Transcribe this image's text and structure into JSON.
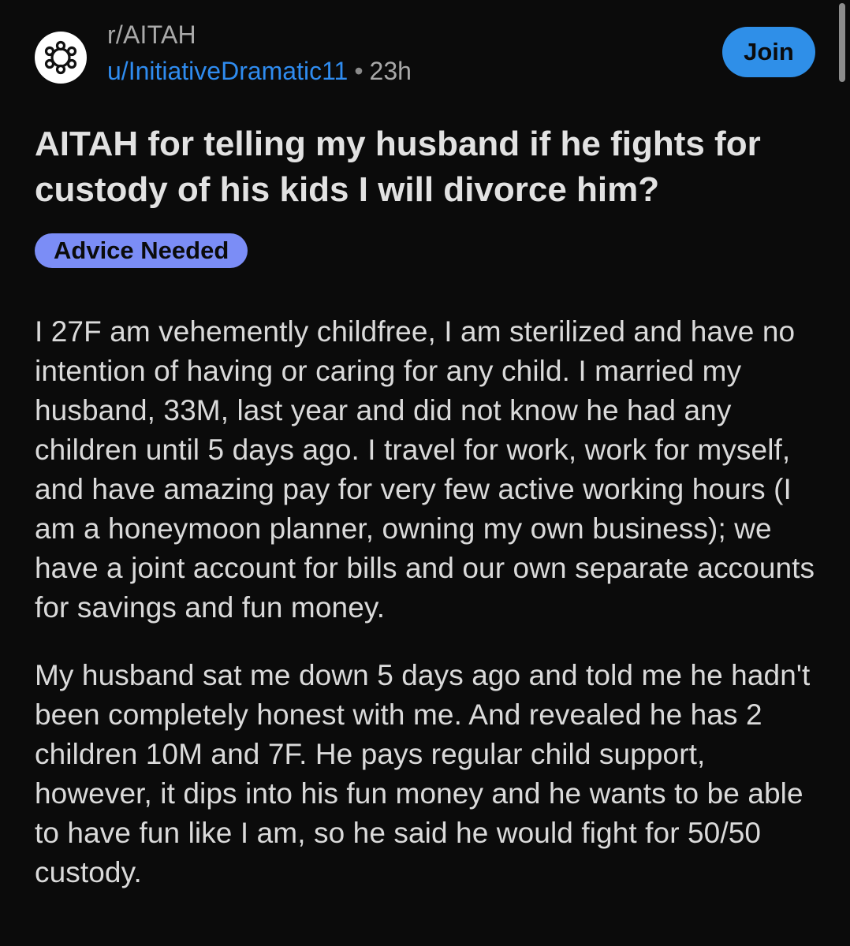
{
  "header": {
    "subreddit": "r/AITAH",
    "author": "u/InitiativeDramatic11",
    "separator": "•",
    "age": "23h",
    "join_label": "Join",
    "avatar_icon": "snoo-avatar-icon"
  },
  "post": {
    "title": "AITAH for telling my husband if he fights for custody of his kids I will divorce him?",
    "flair": "Advice Needed",
    "paragraphs": [
      "I 27F am vehemently childfree, I am sterilized and have no intention of having or caring for any child. I married my husband, 33M, last year and did not know he had any children until 5 days ago. I travel for work, work for myself, and have amazing pay for very few active working hours (I am a honeymoon planner, owning my own business); we have a joint account for bills and our own separate accounts for savings and fun money.",
      "My husband sat me down 5 days ago and told me he hadn't been completely honest with me. And revealed he has 2 children 10M and 7F. He pays regular child support, however, it dips into his fun money and he wants to be able to have fun like I am, so he said he would fight for 50/50 custody."
    ]
  },
  "colors": {
    "background": "#0b0b0b",
    "link": "#2f8cf0",
    "join_button": "#2f8fe8",
    "flair": "#7b8df6"
  }
}
